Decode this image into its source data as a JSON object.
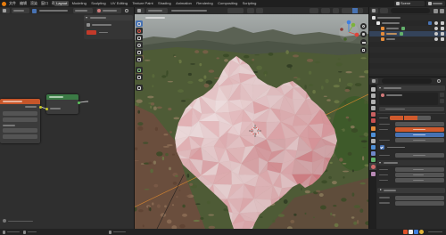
{
  "topbar": {
    "menu": [
      "文件",
      "编辑",
      "渲染",
      "窗口",
      "帮助"
    ],
    "workspaces": [
      "Layout",
      "Modeling",
      "Sculpting",
      "UV Editing",
      "Texture Paint",
      "Shading",
      "Animation",
      "Rendering",
      "Compositing",
      "Scripting"
    ],
    "active_workspace": "Layout",
    "scene": "Scene"
  },
  "colors": {
    "accent_blue": "#4772b3",
    "slider_orange": "#cf5a2d",
    "texture_node_header": "#c6562a",
    "shader_node_header": "#3b7a45",
    "mesh_tint": "#ecd0d0",
    "light_line": "#e08a2e"
  },
  "icons": {
    "app": "blender-logo-icon",
    "viewport_tools": [
      "select-box-icon",
      "cursor-icon",
      "move-icon",
      "rotate-icon",
      "scale-icon",
      "transform-icon",
      "annotate-icon",
      "measure-icon",
      "add-cube-icon"
    ],
    "navigation": [
      "zoom-icon",
      "pan-hand-icon",
      "camera-view-icon",
      "ortho-grid-icon"
    ],
    "outliner": [
      "scene-collection-icon",
      "collection-icon",
      "object-icon",
      "mesh-data-icon",
      "eye-icon",
      "camera-visibility-icon"
    ]
  }
}
